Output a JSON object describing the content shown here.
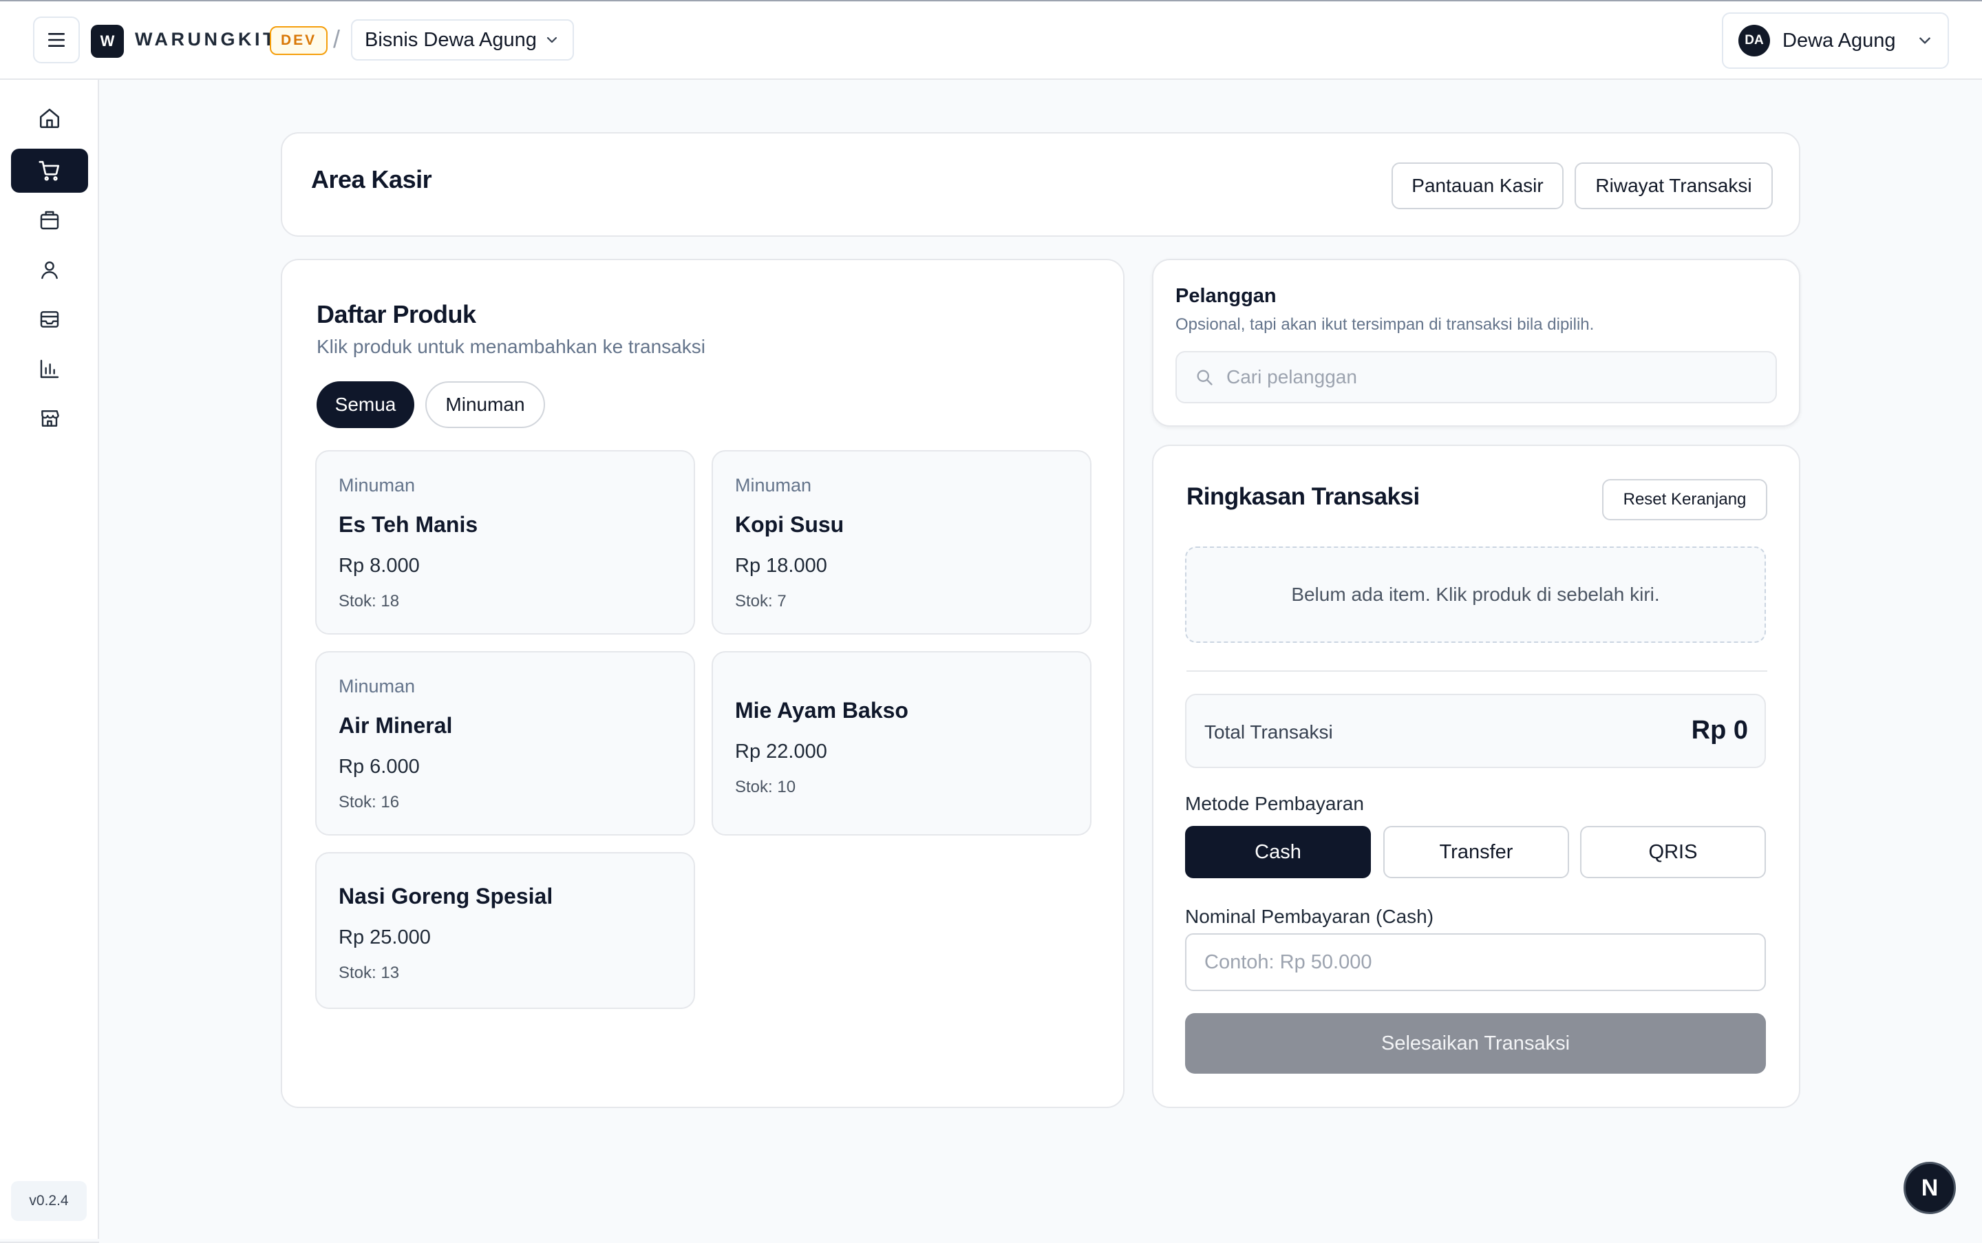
{
  "header": {
    "logo_letter": "W",
    "brand": "WARUNGKIT",
    "env_badge": "DEV",
    "separator": "/",
    "business_name": "Bisnis Dewa Agung",
    "user_initials": "DA",
    "user_name": "Dewa Agung"
  },
  "sidebar": {
    "items": [
      {
        "icon": "home-icon"
      },
      {
        "icon": "cart-icon",
        "active": true
      },
      {
        "icon": "package-icon"
      },
      {
        "icon": "user-icon"
      },
      {
        "icon": "inbox-icon"
      },
      {
        "icon": "bar-chart-icon"
      },
      {
        "icon": "store-icon"
      }
    ],
    "version": "v0.2.4"
  },
  "page": {
    "title": "Area Kasir",
    "btn_monitor": "Pantauan Kasir",
    "btn_history": "Riwayat Transaksi"
  },
  "products": {
    "title": "Daftar Produk",
    "subtitle": "Klik produk untuk menambahkan ke transaksi",
    "filters": [
      "Semua",
      "Minuman"
    ],
    "items": [
      {
        "category": "Minuman",
        "name": "Es Teh Manis",
        "price": "Rp 8.000",
        "stock": "Stok: 18"
      },
      {
        "category": "Minuman",
        "name": "Kopi Susu",
        "price": "Rp 18.000",
        "stock": "Stok: 7"
      },
      {
        "category": "Minuman",
        "name": "Air Mineral",
        "price": "Rp 6.000",
        "stock": "Stok: 16"
      },
      {
        "category": "",
        "name": "Mie Ayam Bakso",
        "price": "Rp 22.000",
        "stock": "Stok: 10"
      },
      {
        "category": "",
        "name": "Nasi Goreng Spesial",
        "price": "Rp 25.000",
        "stock": "Stok: 13"
      }
    ]
  },
  "customer": {
    "title": "Pelanggan",
    "subtitle": "Opsional, tapi akan ikut tersimpan di transaksi bila dipilih.",
    "search_placeholder": "Cari pelanggan"
  },
  "summary": {
    "title": "Ringkasan Transaksi",
    "reset": "Reset Keranjang",
    "empty": "Belum ada item. Klik produk di sebelah kiri.",
    "total_label": "Total Transaksi",
    "total_value": "Rp 0",
    "method_label": "Metode Pembayaran",
    "methods": [
      "Cash",
      "Transfer",
      "QRIS"
    ],
    "nominal_label": "Nominal Pembayaran (Cash)",
    "nominal_placeholder": "Contoh: Rp 50.000",
    "finish": "Selesaikan Transaksi"
  },
  "fab_letter": "N",
  "colors": {
    "primary": "#0f172a",
    "accent_badge": "#d97706",
    "disabled_button": "#8b8f98"
  }
}
